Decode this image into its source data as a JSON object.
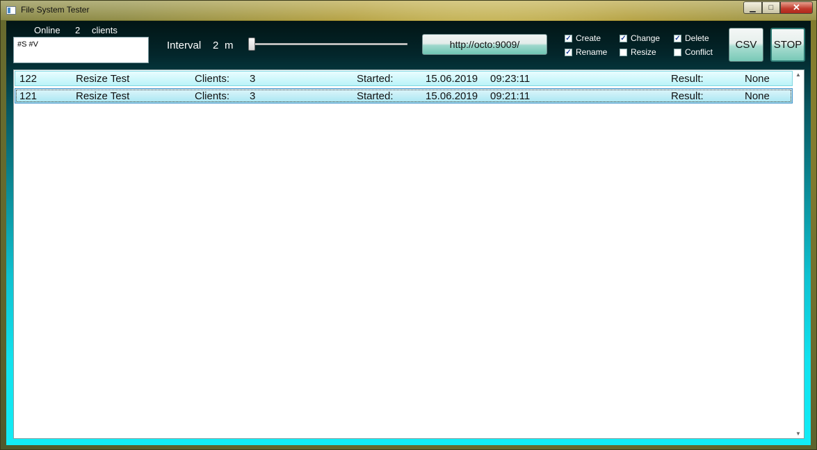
{
  "window": {
    "title": "File System Tester",
    "icon": "app-window-icon"
  },
  "caption": {
    "min": "▁",
    "max": "□",
    "close": "✕"
  },
  "status": {
    "online_label": "Online",
    "online_count": "2",
    "clients_label": "clients"
  },
  "filter": {
    "value": "#S #V"
  },
  "interval": {
    "label": "Interval",
    "value": "2",
    "unit": "m",
    "slider_position": 0
  },
  "server": {
    "url": "http://octo:9009/"
  },
  "options": [
    {
      "label": "Create",
      "checked": true
    },
    {
      "label": "Rename",
      "checked": true
    },
    {
      "label": "Change",
      "checked": true
    },
    {
      "label": "Resize",
      "checked": false
    },
    {
      "label": "Delete",
      "checked": true
    },
    {
      "label": "Conflict",
      "checked": false
    }
  ],
  "buttons": {
    "csv": "CSV",
    "stop": "STOP"
  },
  "tests": [
    {
      "id": "122",
      "name": "Resize Test",
      "clients_label": "Clients:",
      "clients": "3",
      "started_label": "Started:",
      "date": "15.06.2019",
      "time": "09:23:11",
      "result_label": "Result:",
      "result": "None",
      "selected": false
    },
    {
      "id": "121",
      "name": "Resize Test",
      "clients_label": "Clients:",
      "clients": "3",
      "started_label": "Started:",
      "date": "15.06.2019",
      "time": "09:21:11",
      "result_label": "Result:",
      "result": "None",
      "selected": true
    }
  ],
  "colors": {
    "accent": "#12e2ee",
    "row_bg": "#baf3f8",
    "selected_border": "#3d8fc9"
  }
}
